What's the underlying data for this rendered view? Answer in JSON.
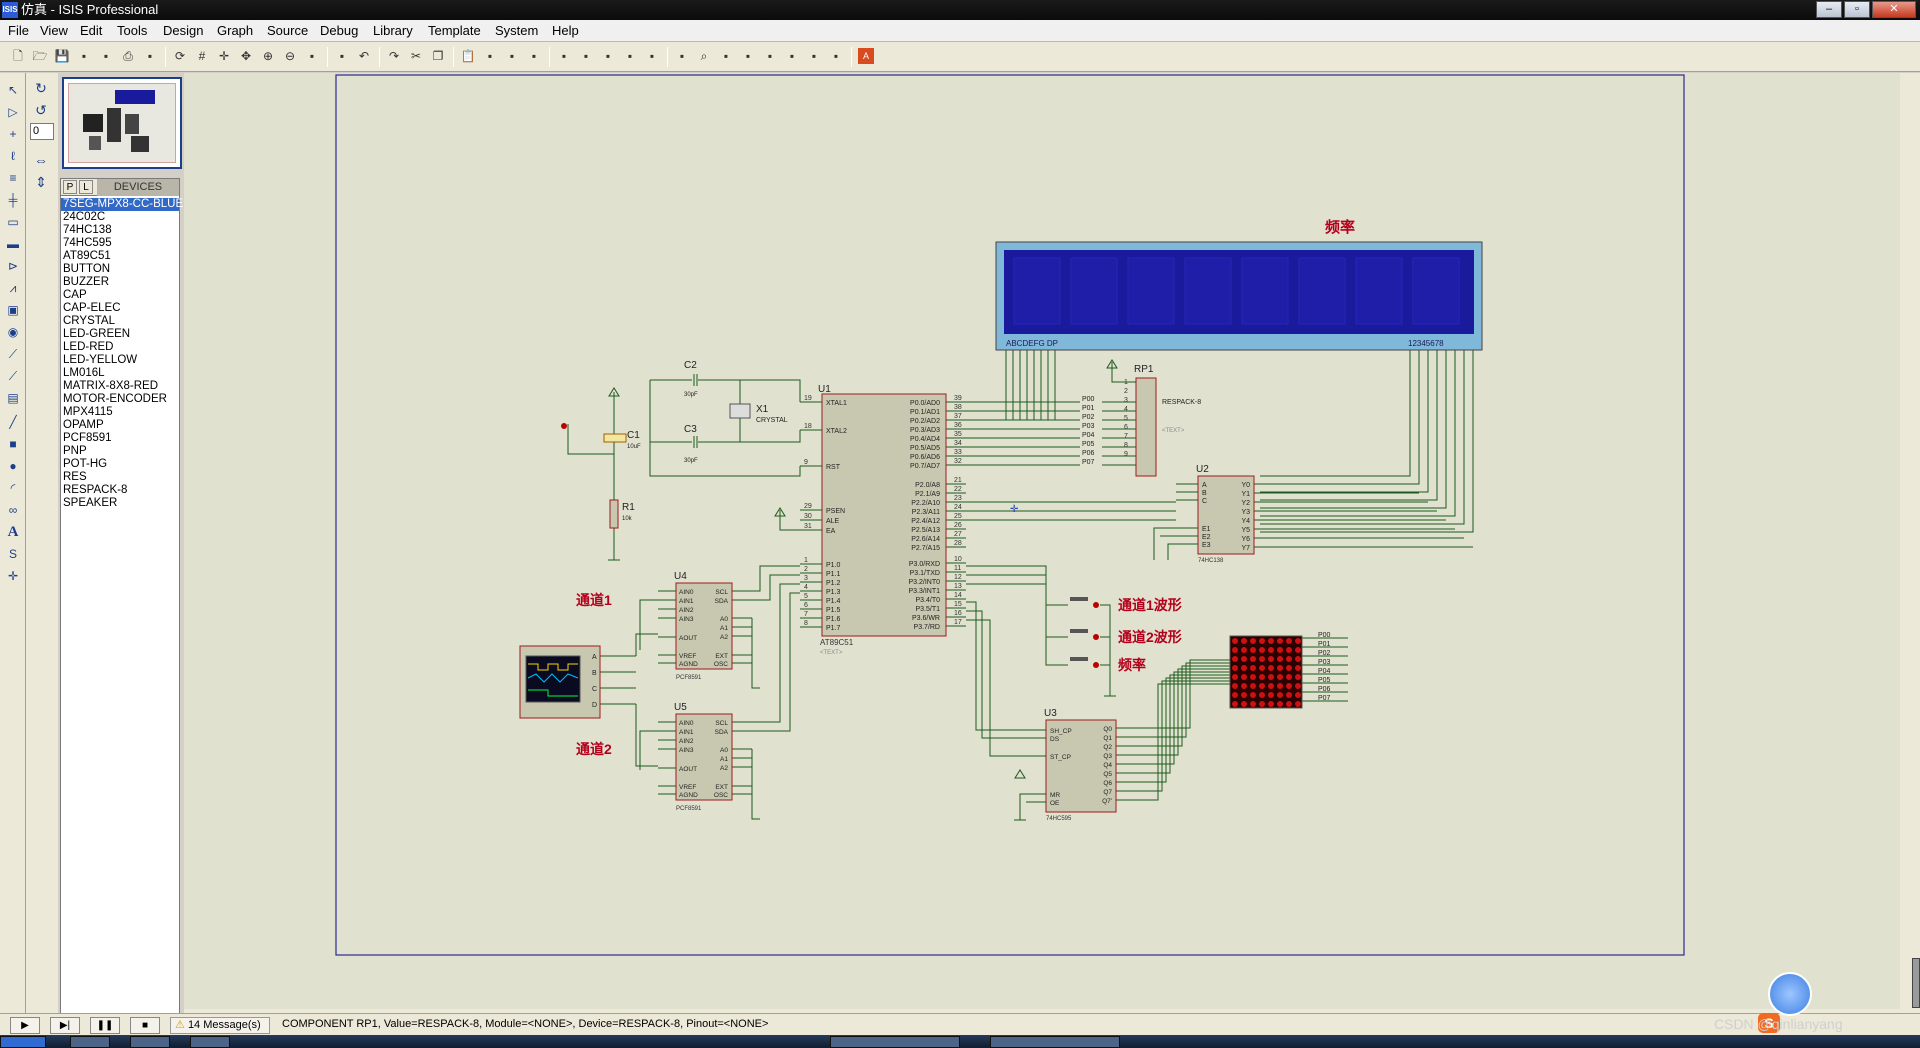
{
  "window": {
    "app_icon_text": "ISIS",
    "title": "仿真 - ISIS Professional",
    "min": "–",
    "max": "▫",
    "close": "✕"
  },
  "menu": [
    "File",
    "View",
    "Edit",
    "Tools",
    "Design",
    "Graph",
    "Source",
    "Debug",
    "Library",
    "Template",
    "System",
    "Help"
  ],
  "toolbar_icons": [
    "new-icon",
    "open-icon",
    "save-icon",
    "import-icon",
    "export-icon",
    "print-icon",
    "print-area-icon",
    "refresh-icon",
    "grid-icon",
    "origin-icon",
    "pan-icon",
    "zoom-in-icon",
    "zoom-out-icon",
    "zoom-all-icon",
    "zoom-area-icon",
    "undo-icon",
    "redo-icon",
    "cut-icon",
    "copy-icon",
    "paste-icon",
    "block-copy-icon",
    "block-move-icon",
    "block-rotate-icon",
    "block-delete-icon",
    "pick-device-icon",
    "make-device-icon",
    "packaging-icon",
    "decompose-icon",
    "wire-autorouter-icon",
    "search-icon",
    "property-assign-icon",
    "new-sheet-icon",
    "remove-sheet-icon",
    "exit-parent-icon",
    "bill-of-materials-icon",
    "electrical-rule-check-icon",
    "netlist-to-ares-icon"
  ],
  "rotation": {
    "value": "0"
  },
  "device_panel": {
    "p_label": "P",
    "l_label": "L",
    "header": "DEVICES",
    "items": [
      "7SEG-MPX8-CC-BLUE",
      "24C02C",
      "74HC138",
      "74HC595",
      "AT89C51",
      "BUTTON",
      "BUZZER",
      "CAP",
      "CAP-ELEC",
      "CRYSTAL",
      "LED-GREEN",
      "LED-RED",
      "LED-YELLOW",
      "LM016L",
      "MATRIX-8X8-RED",
      "MOTOR-ENCODER",
      "MPX4115",
      "OPAMP",
      "PCF8591",
      "PNP",
      "POT-HG",
      "RES",
      "RESPACK-8",
      "SPEAKER"
    ],
    "selected_index": 0
  },
  "schematic": {
    "labels": {
      "freq_title": "频率",
      "ch1": "通道1",
      "ch2": "通道2",
      "ch1_wave": "通道1波形",
      "ch2_wave": "通道2波形",
      "freq": "频率"
    },
    "components": {
      "u1_ref": "U1",
      "u1_part": "AT89C51",
      "u1_text": "<TEXT>",
      "c1_ref": "C1",
      "c1_val": "10uF",
      "c2_ref": "C2",
      "c2_val": "30pF",
      "c3_ref": "C3",
      "c3_val": "30pF",
      "x1_ref": "X1",
      "x1_val": "CRYSTAL",
      "r1_ref": "R1",
      "r1_val": "10k",
      "rp1_ref": "RP1",
      "rp1_val": "RESPACK-8",
      "u2_ref": "U2",
      "u2_part": "74HC138",
      "u3_ref": "U3",
      "u3_part": "74HC595",
      "u4_ref": "U4",
      "u4_part": "PCF8591",
      "u5_ref": "U5",
      "u5_part": "PCF8591",
      "seg_left": "ABCDEFG  DP",
      "seg_right": "12345678",
      "text_placeholder": "<TEXT>"
    },
    "u1_left_pins": [
      {
        "n": "19",
        "name": "XTAL1"
      },
      {
        "n": "18",
        "name": "XTAL2"
      },
      {
        "n": "9",
        "name": "RST"
      },
      {
        "n": "29",
        "name": "PSEN"
      },
      {
        "n": "30",
        "name": "ALE"
      },
      {
        "n": "31",
        "name": "EA"
      },
      {
        "n": "1",
        "name": "P1.0"
      },
      {
        "n": "2",
        "name": "P1.1"
      },
      {
        "n": "3",
        "name": "P1.2"
      },
      {
        "n": "4",
        "name": "P1.3"
      },
      {
        "n": "5",
        "name": "P1.4"
      },
      {
        "n": "6",
        "name": "P1.5"
      },
      {
        "n": "7",
        "name": "P1.6"
      },
      {
        "n": "8",
        "name": "P1.7"
      }
    ],
    "u1_right_pins": [
      {
        "n": "39",
        "name": "P0.0/AD0"
      },
      {
        "n": "38",
        "name": "P0.1/AD1"
      },
      {
        "n": "37",
        "name": "P0.2/AD2"
      },
      {
        "n": "36",
        "name": "P0.3/AD3"
      },
      {
        "n": "35",
        "name": "P0.4/AD4"
      },
      {
        "n": "34",
        "name": "P0.5/AD5"
      },
      {
        "n": "33",
        "name": "P0.6/AD6"
      },
      {
        "n": "32",
        "name": "P0.7/AD7"
      },
      {
        "n": "21",
        "name": "P2.0/A8"
      },
      {
        "n": "22",
        "name": "P2.1/A9"
      },
      {
        "n": "23",
        "name": "P2.2/A10"
      },
      {
        "n": "24",
        "name": "P2.3/A11"
      },
      {
        "n": "25",
        "name": "P2.4/A12"
      },
      {
        "n": "26",
        "name": "P2.5/A13"
      },
      {
        "n": "27",
        "name": "P2.6/A14"
      },
      {
        "n": "28",
        "name": "P2.7/A15"
      },
      {
        "n": "10",
        "name": "P3.0/RXD"
      },
      {
        "n": "11",
        "name": "P3.1/TXD"
      },
      {
        "n": "12",
        "name": "P3.2/INT0"
      },
      {
        "n": "13",
        "name": "P3.3/INT1"
      },
      {
        "n": "14",
        "name": "P3.4/T0"
      },
      {
        "n": "15",
        "name": "P3.5/T1"
      },
      {
        "n": "16",
        "name": "P3.6/WR"
      },
      {
        "n": "17",
        "name": "P3.7/RD"
      }
    ],
    "p0_nets": [
      "P00",
      "P01",
      "P02",
      "P03",
      "P04",
      "P05",
      "P06",
      "P07"
    ],
    "rp1_pins": [
      "1",
      "2",
      "3",
      "4",
      "5",
      "6",
      "7",
      "8",
      "9"
    ],
    "u2_left": [
      "A",
      "B",
      "C",
      "E1",
      "E2",
      "E3"
    ],
    "u2_right": [
      "Y0",
      "Y1",
      "Y2",
      "Y3",
      "Y4",
      "Y5",
      "Y6",
      "Y7"
    ],
    "u3_left": [
      "SH_CP",
      "DS",
      "ST_CP",
      "MR",
      "OE"
    ],
    "u3_right": [
      "Q0",
      "Q1",
      "Q2",
      "Q3",
      "Q4",
      "Q5",
      "Q6",
      "Q7",
      "Q7'"
    ],
    "pcf_left": [
      "AIN0",
      "AIN1",
      "AIN2",
      "AIN3",
      "AOUT",
      "VREF",
      "AGND"
    ],
    "pcf_right": [
      "SCL",
      "SDA",
      "A0",
      "A1",
      "A2",
      "EXT",
      "OSC"
    ],
    "scope_ch": [
      "A",
      "B",
      "C",
      "D"
    ]
  },
  "status": {
    "play": "▶",
    "step": "▶|",
    "pause": "❚❚",
    "stop": "■",
    "messages": "14 Message(s)",
    "text": "COMPONENT RP1, Value=RESPACK-8, Module=<NONE>, Device=RESPACK-8, Pinout=<NONE>"
  },
  "watermark": "CSDN @qinlianyang",
  "colors": {
    "sheet": "#e1e1d0",
    "wire": "#1c5a1c",
    "part_body": "#c8c8b0",
    "part_border": "#9c1c1c",
    "lcd": "#1a1a9c",
    "matrix": "#cc1111",
    "label_red": "#b3001b",
    "border_blue": "#2a2a8c"
  }
}
